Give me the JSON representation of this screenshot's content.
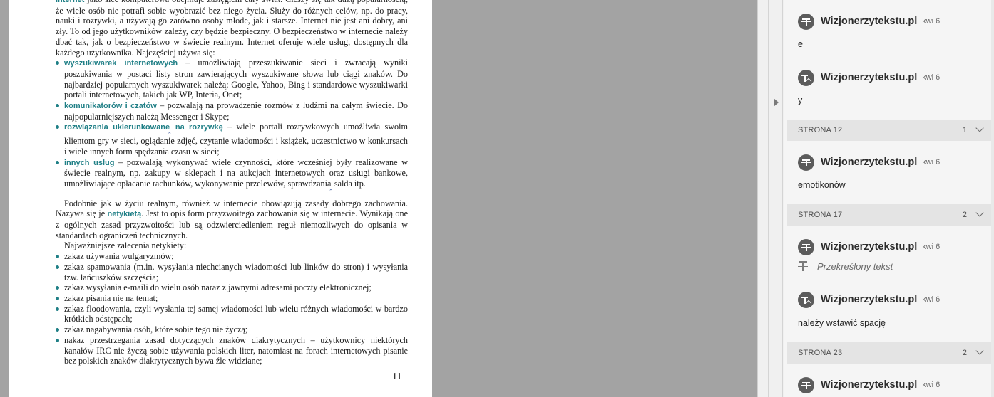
{
  "document": {
    "intro_kw": "internet",
    "intro_text": " jako sieć komputerowa obejmuje zasięgiem cały świat. Cieszy się tak dużą popularnością, że wiele osób nie potrafi sobie wyobrazić bez niego życia. Służy do różnych celów, np. do pracy, nauki i rozrywki, a używają go zarówno osoby młode, jak i starsze. Internet nie jest ani dobry, ani zły. To od jego użytkowników zależy, czy będzie bezpieczny. O bezpieczeństwo w internecie należy dbać tak, jak o bezpieczeństwo w świecie realnym. Internet oferuje wiele usług, dostępnych dla każdego użytkownika. Najczęściej używa się:",
    "bullets1": [
      {
        "kw": "wyszukiwarek internetowych",
        "text": " – umożliwiają przeszukiwanie sieci i zwracają wyniki poszukiwania w postaci listy stron zawierających wyszukiwane słowa lub ciągi znaków. Do najbardziej popularnych wyszukiwarek należą: Google, Yahoo, Bing i standardowe wyszukiwarki portali internetowych, takich jak WP, Interia, Onet;"
      },
      {
        "kw": "komunikatorów i czatów",
        "text": " – pozwalają na prowadzenie rozmów z ludźmi na całym świecie. Do najpopularniejszych należą Messenger i Skype;"
      },
      {
        "kw_strike": "rozwiązania ukierunkowane",
        "kw_rest": " na rozrywkę",
        "text": " – wiele portali rozrywkowych umożliwia swoim klientom gry w sieci, oglądanie zdjęć, czytanie wiadomości i książek, uczestnictwo w konkursach i wiele innych form spędzania czasu w sieci;"
      },
      {
        "kw": "innych usług",
        "text_a": " – pozwalają wykonywać wiele czynności, które wcześniej były realizowane w świecie realnym, np. zakupy w sklepach i na aukcjach internetowych oraz usługi bankowe, umożliwiające opłacanie rachunków, wykonywanie przelewów, sprawdzania",
        "text_b": " salda itp."
      }
    ],
    "para2_a": "Podobnie jak w życiu realnym, również w internecie obowiązują zasady dobrego zachowania. Nazywa się je ",
    "para2_kw": "netykietą",
    "para2_b": ". Jest to opis form przyzwoitego zachowania się w internecie. Wynikają one z ogólnych zasad przyzwoitości lub są odzwierciedleniem reguł niemożliwych do opisania w standardach ograniczeń technicznych.",
    "para3": "Najważniejsze zalecenia netykiety:",
    "bullets2": [
      "zakaz używania wulgaryzmów;",
      "zakaz spamowania (m.in. wysyłania niechcianych wiadomości lub linków do stron) i wysyłania tzw. łańcuszków szczęścia;",
      "zakaz wysyłania e-maili do wielu osób naraz z jawnymi adresami poczty elektronicznej;",
      "zakaz pisania nie na temat;",
      "zakaz floodowania, czyli wysłania tej samej wiadomości lub wielu różnych wiadomości w bardzo krótkich odstępach;",
      "zakaz nagabywania osób, które sobie tego nie życzą;",
      "nakaz przestrzegania zasad dotyczących znaków diakrytycznych – użytkownicy niektórych kanałów IRC nie życzą sobie używania polskich liter, natomiast na forach internetowych pisanie bez polskich znaków diakrytycznych bywa źle widziane;"
    ],
    "page_number": "11"
  },
  "comments_panel": {
    "items": [
      {
        "type": "comment",
        "author": "Wizjonerzytekstu.pl",
        "date": "kwi 6",
        "avatar": "strikethrough-icon",
        "body": "e"
      },
      {
        "type": "comment",
        "author": "Wizjonerzytekstu.pl",
        "date": "kwi 6",
        "avatar": "insert-text-icon",
        "body": "y"
      },
      {
        "type": "section",
        "label": "STRONA 12",
        "count": "1"
      },
      {
        "type": "comment",
        "author": "Wizjonerzytekstu.pl",
        "date": "kwi 6",
        "avatar": "strikethrough-icon",
        "body": "emotikonów"
      },
      {
        "type": "section",
        "label": "STRONA 17",
        "count": "2"
      },
      {
        "type": "comment",
        "author": "Wizjonerzytekstu.pl",
        "date": "kwi 6",
        "avatar": "strikethrough-icon",
        "body_italic": "Przekreślony tekst"
      },
      {
        "type": "comment",
        "author": "Wizjonerzytekstu.pl",
        "date": "kwi 6",
        "avatar": "insert-text-icon",
        "body": "należy wstawić spację"
      },
      {
        "type": "section",
        "label": "STRONA 23",
        "count": "2"
      },
      {
        "type": "comment",
        "author": "Wizjonerzytekstu.pl",
        "date": "kwi 6",
        "avatar": "strikethrough-icon"
      }
    ]
  },
  "colors": {
    "keyword": "#1f7f86",
    "background_gray": "#a3a3a3",
    "panel_bg": "#f5f5f5",
    "section_bg": "#e4e4e4",
    "avatar_bg": "#5c5c5c"
  }
}
